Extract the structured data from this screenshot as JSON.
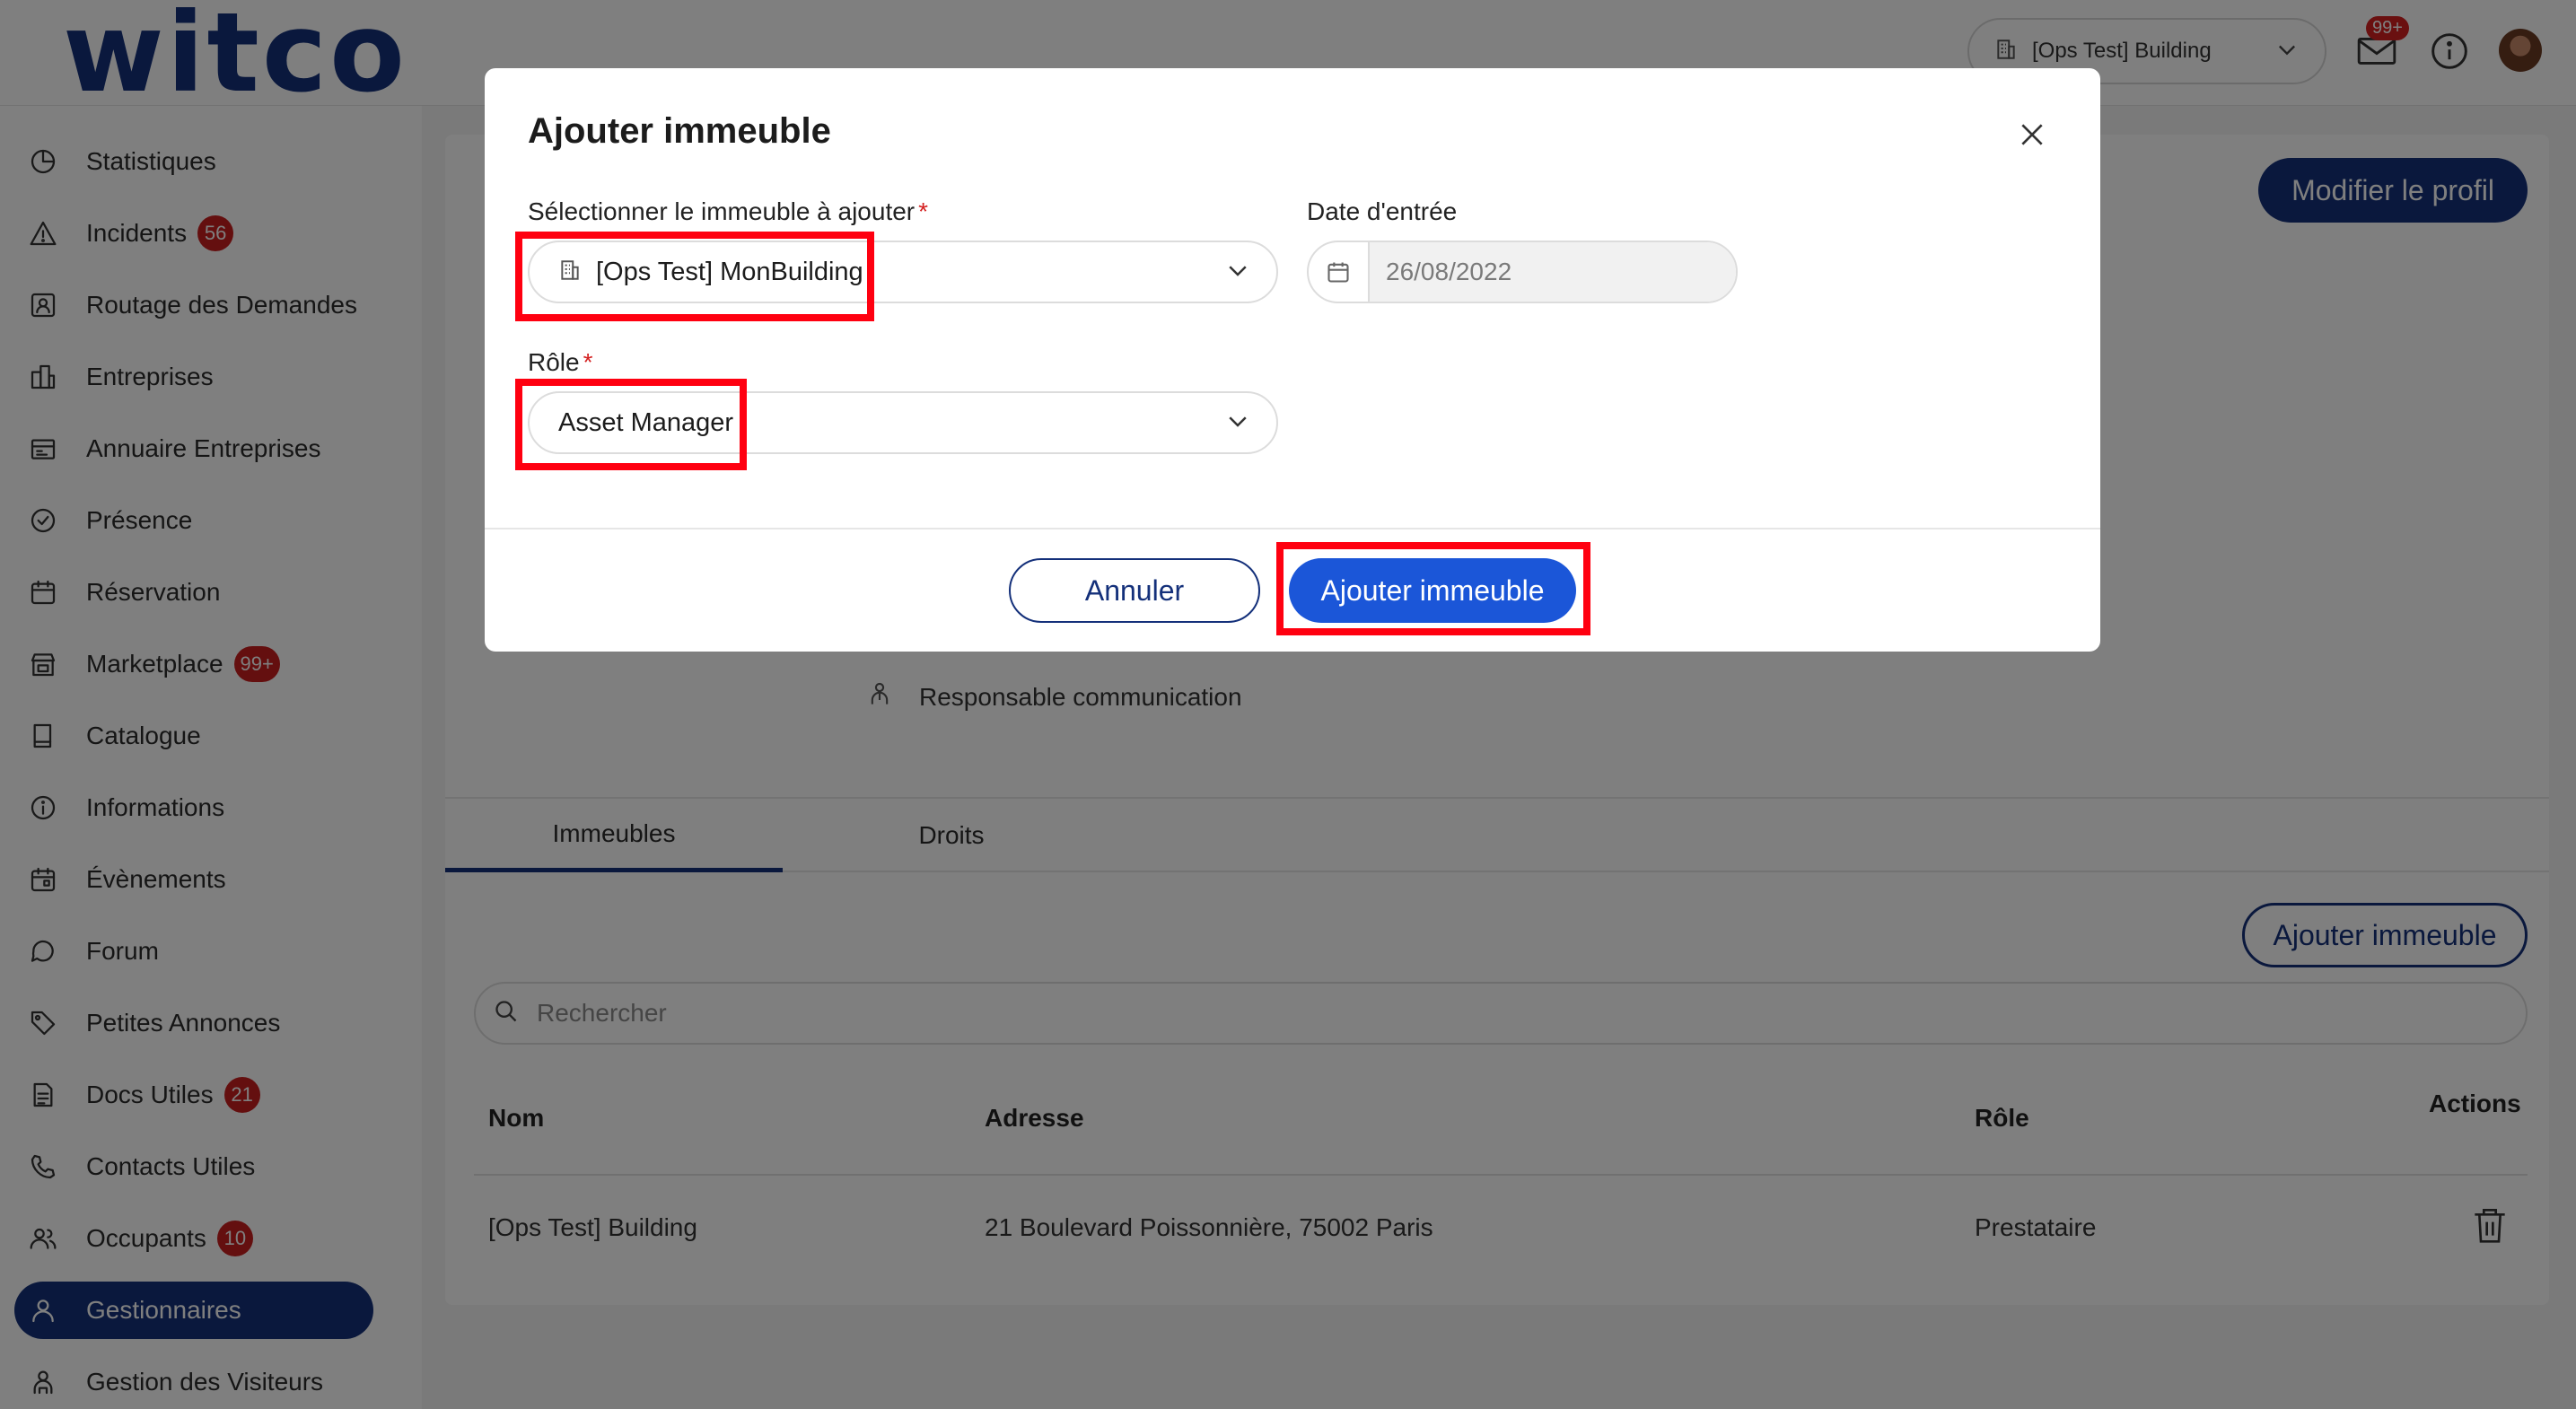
{
  "header": {
    "logo": "witco",
    "building_selector": "[Ops Test] Building",
    "notifications_badge": "99+"
  },
  "sidebar": {
    "items": [
      {
        "label": "Statistiques",
        "icon": "pie-chart-icon"
      },
      {
        "label": "Incidents",
        "icon": "warning-icon",
        "badge": "56"
      },
      {
        "label": "Routage des Demandes",
        "icon": "contact-card-icon"
      },
      {
        "label": "Entreprises",
        "icon": "buildings-icon"
      },
      {
        "label": "Annuaire Entreprises",
        "icon": "directory-icon"
      },
      {
        "label": "Présence",
        "icon": "check-circle-icon"
      },
      {
        "label": "Réservation",
        "icon": "calendar-icon"
      },
      {
        "label": "Marketplace",
        "icon": "store-icon",
        "badge": "99+"
      },
      {
        "label": "Catalogue",
        "icon": "book-icon"
      },
      {
        "label": "Informations",
        "icon": "info-icon"
      },
      {
        "label": "Évènements",
        "icon": "calendar-event-icon"
      },
      {
        "label": "Forum",
        "icon": "chat-bubble-icon"
      },
      {
        "label": "Petites Annonces",
        "icon": "tag-icon"
      },
      {
        "label": "Docs Utiles",
        "icon": "document-icon",
        "badge": "21"
      },
      {
        "label": "Contacts Utiles",
        "icon": "phone-icon"
      },
      {
        "label": "Occupants",
        "icon": "users-icon",
        "badge": "10"
      },
      {
        "label": "Gestionnaires",
        "icon": "user-icon",
        "active": true
      },
      {
        "label": "Gestion des Visiteurs",
        "icon": "visitor-icon"
      }
    ]
  },
  "profile": {
    "edit_button": "Modifier le profil",
    "role": "Responsable communication"
  },
  "tabs": [
    {
      "label": "Immeubles",
      "active": true
    },
    {
      "label": "Droits",
      "active": false
    }
  ],
  "buildings": {
    "add_button": "Ajouter immeuble",
    "search_placeholder": "Rechercher",
    "columns": {
      "name": "Nom",
      "address": "Adresse",
      "role": "Rôle",
      "actions": "Actions"
    },
    "rows": [
      {
        "name": "[Ops Test] Building",
        "address": "21 Boulevard Poissonnière, 75002 Paris",
        "role": "Prestataire"
      }
    ]
  },
  "modal": {
    "title": "Ajouter immeuble",
    "building_label": "Sélectionner le immeuble à ajouter",
    "building_value": "[Ops Test] MonBuilding",
    "date_label": "Date d'entrée",
    "date_value": "26/08/2022",
    "role_label": "Rôle",
    "role_value": "Asset Manager",
    "required_mark": "*",
    "cancel_button": "Annuler",
    "submit_button": "Ajouter immeuble"
  },
  "colors": {
    "brand": "#14307a",
    "primary_button": "#1b56d8",
    "badge": "#c81e1e",
    "highlight": "#ff0010"
  }
}
